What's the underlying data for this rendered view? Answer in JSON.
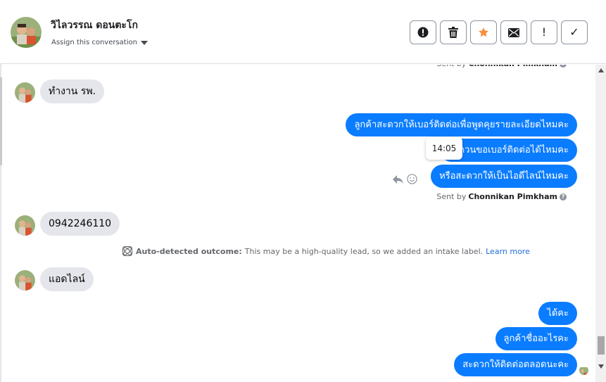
{
  "header": {
    "contact_name": "วิไลวรรณ ดอนตะโก",
    "assign_label": "Assign this conversation",
    "actions": [
      {
        "icon": "alert-circle-icon",
        "label": ""
      },
      {
        "icon": "trash-icon",
        "label": ""
      },
      {
        "icon": "star-icon",
        "label": ""
      },
      {
        "icon": "envelope-icon",
        "label": ""
      },
      {
        "icon": "exclamation-icon",
        "label": "!"
      },
      {
        "icon": "check-icon",
        "label": "✓"
      }
    ]
  },
  "thread": {
    "sent_by_prefix": "Sent by",
    "sent_by_name": "Chonnikan Pimkham",
    "tooltip_time": "14:05",
    "messages": [
      {
        "side": "in",
        "text": "ทำงาน รพ."
      },
      {
        "side": "out",
        "text": "ลูกค้าสะดวกให้เบอร์ติดต่อเพื่อพูดคุยรายละเอียดไหมคะ"
      },
      {
        "side": "out",
        "text": "รบกวนขอเบอร์ติดต่อได้ไหมคะ"
      },
      {
        "side": "out",
        "text": "หรือสะดวกให้เป็นไอดีไลน์ไหมคะ"
      },
      {
        "side": "in",
        "text": "0942246110"
      },
      {
        "side": "in",
        "text": "แอดไลน์"
      },
      {
        "side": "out",
        "text": "ได้คะ"
      },
      {
        "side": "out",
        "text": "ลูกค้าชื่ออะไรคะ"
      },
      {
        "side": "out",
        "text": "สะดวกให้ติดต่อตลอดนะคะ"
      }
    ],
    "auto_detected": {
      "label": "Auto-detected outcome:",
      "text": "This may be a high-quality lead, so we added an intake label.",
      "link": "Learn more"
    }
  },
  "colors": {
    "outgoing_bubble": "#0a7cff",
    "incoming_bubble": "#e4e6eb",
    "star": "#f5903d",
    "link": "#216fdb"
  }
}
